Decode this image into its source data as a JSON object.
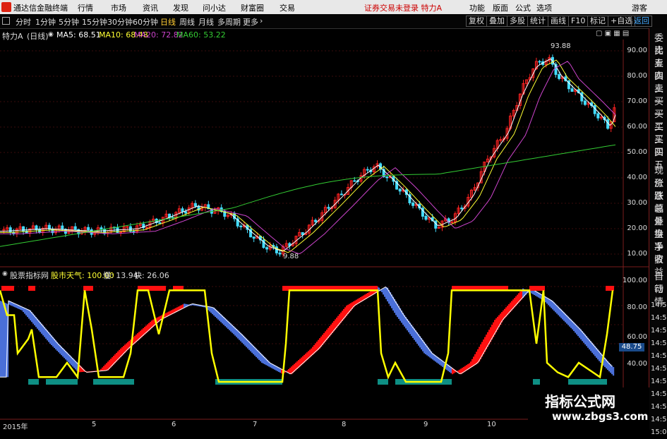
{
  "app": {
    "title": "通达信金融终端",
    "notice": "证券交易未登录  特力A"
  },
  "menu": [
    "行情",
    "市场",
    "资讯",
    "发现",
    "问小达",
    "财富圈",
    "交易"
  ],
  "menu_right": [
    "功能",
    "版面",
    "公式",
    "选项",
    "游客"
  ],
  "periods": [
    "分时",
    "1分钟",
    "5分钟",
    "15分钟",
    "30分钟",
    "60分钟",
    "日线",
    "周线",
    "月线",
    "多周期",
    "更多"
  ],
  "active_period": "日线",
  "right_tools": [
    "复权",
    "叠加",
    "多股",
    "统计",
    "画线",
    "F10",
    "标记",
    "+自选",
    "返回"
  ],
  "sidebar": [
    "委比",
    "卖五",
    "卖四",
    "卖三",
    "卖一",
    "买一",
    "买二",
    "买三",
    "买四",
    "买五",
    "现价",
    "涨跌",
    "涨幅",
    "总量",
    "外盘",
    "换手",
    "净资",
    "收益",
    "自动",
    "行情"
  ],
  "price_header": {
    "stock": "特力A",
    "freq": "(日线)",
    "ma5": "MA5: 68.51",
    "ma10": "MA10: 68.48",
    "ma20": "MA20: 72.82",
    "ma60": "MA60: 53.22"
  },
  "indicator_header": {
    "name": "股票指标网",
    "weather": "股市天气: 100.00",
    "slow": "慢: 13.94",
    "fast": "快: 26.06"
  },
  "price_axis": [
    "90.00",
    "80.00",
    "70.00",
    "60.00",
    "50.00",
    "40.00",
    "30.00",
    "20.00",
    "10.00"
  ],
  "indicator_axis": [
    "100.00",
    "80.00",
    "60.00",
    "40.00"
  ],
  "indicator_current": "48.75",
  "high_label": "93.88",
  "low_label": "9.88",
  "time_axis": [
    "2015年",
    "5",
    "6",
    "7",
    "8",
    "9",
    "10"
  ],
  "colors": {
    "up": "#ff2222",
    "down": "#44ddff",
    "ma5": "#ffffff",
    "ma10": "#ffff33",
    "ma20": "#cc44cc",
    "ma60": "#33cc33",
    "slow": "#ffff00",
    "fast": "#ffffff",
    "bull_band": "#ff1010",
    "bear_band": "#4a6fd8"
  },
  "watermark": {
    "title": "指标公式网",
    "url": "www.zbgs3.com"
  }
}
